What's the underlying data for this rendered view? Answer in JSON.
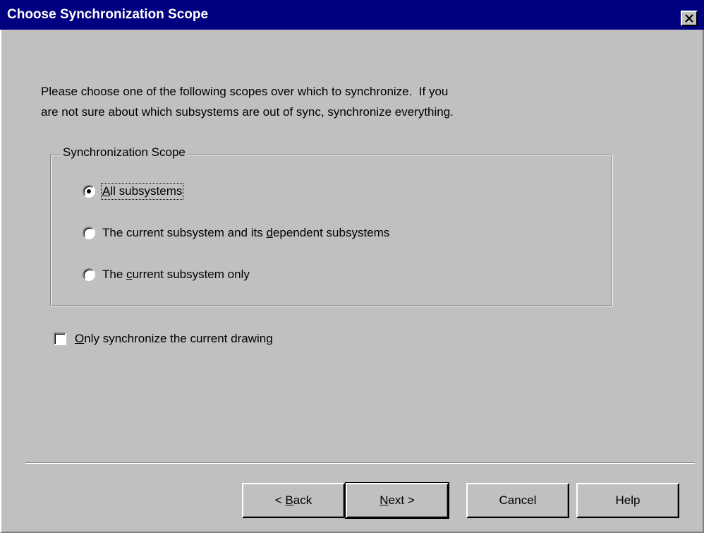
{
  "window": {
    "title": "Choose Synchronization Scope",
    "close_glyph": "×"
  },
  "intro": {
    "line1": "Please choose one of the following scopes over which to synchronize.  If you",
    "line2": "are not sure about which subsystems are out of sync, synchronize everything."
  },
  "scope_group": {
    "legend": "Synchronization Scope",
    "options": [
      {
        "pre": "",
        "accel": "A",
        "post": "ll subsystems",
        "checked": true
      },
      {
        "pre": "The current subsystem and its ",
        "accel": "d",
        "post": "ependent subsystems",
        "checked": false
      },
      {
        "pre": "The ",
        "accel": "c",
        "post": "urrent subsystem only",
        "checked": false
      }
    ]
  },
  "checkbox": {
    "accel": "O",
    "post": "nly synchronize the current drawing",
    "checked": false
  },
  "buttons": {
    "back": {
      "pre": "< ",
      "accel": "B",
      "post": "ack"
    },
    "next": {
      "pre": "",
      "accel": "N",
      "post": "ext >"
    },
    "cancel": "Cancel",
    "help": "Help"
  },
  "colors": {
    "titlebar": "#000080",
    "face": "#c0c0c0"
  }
}
